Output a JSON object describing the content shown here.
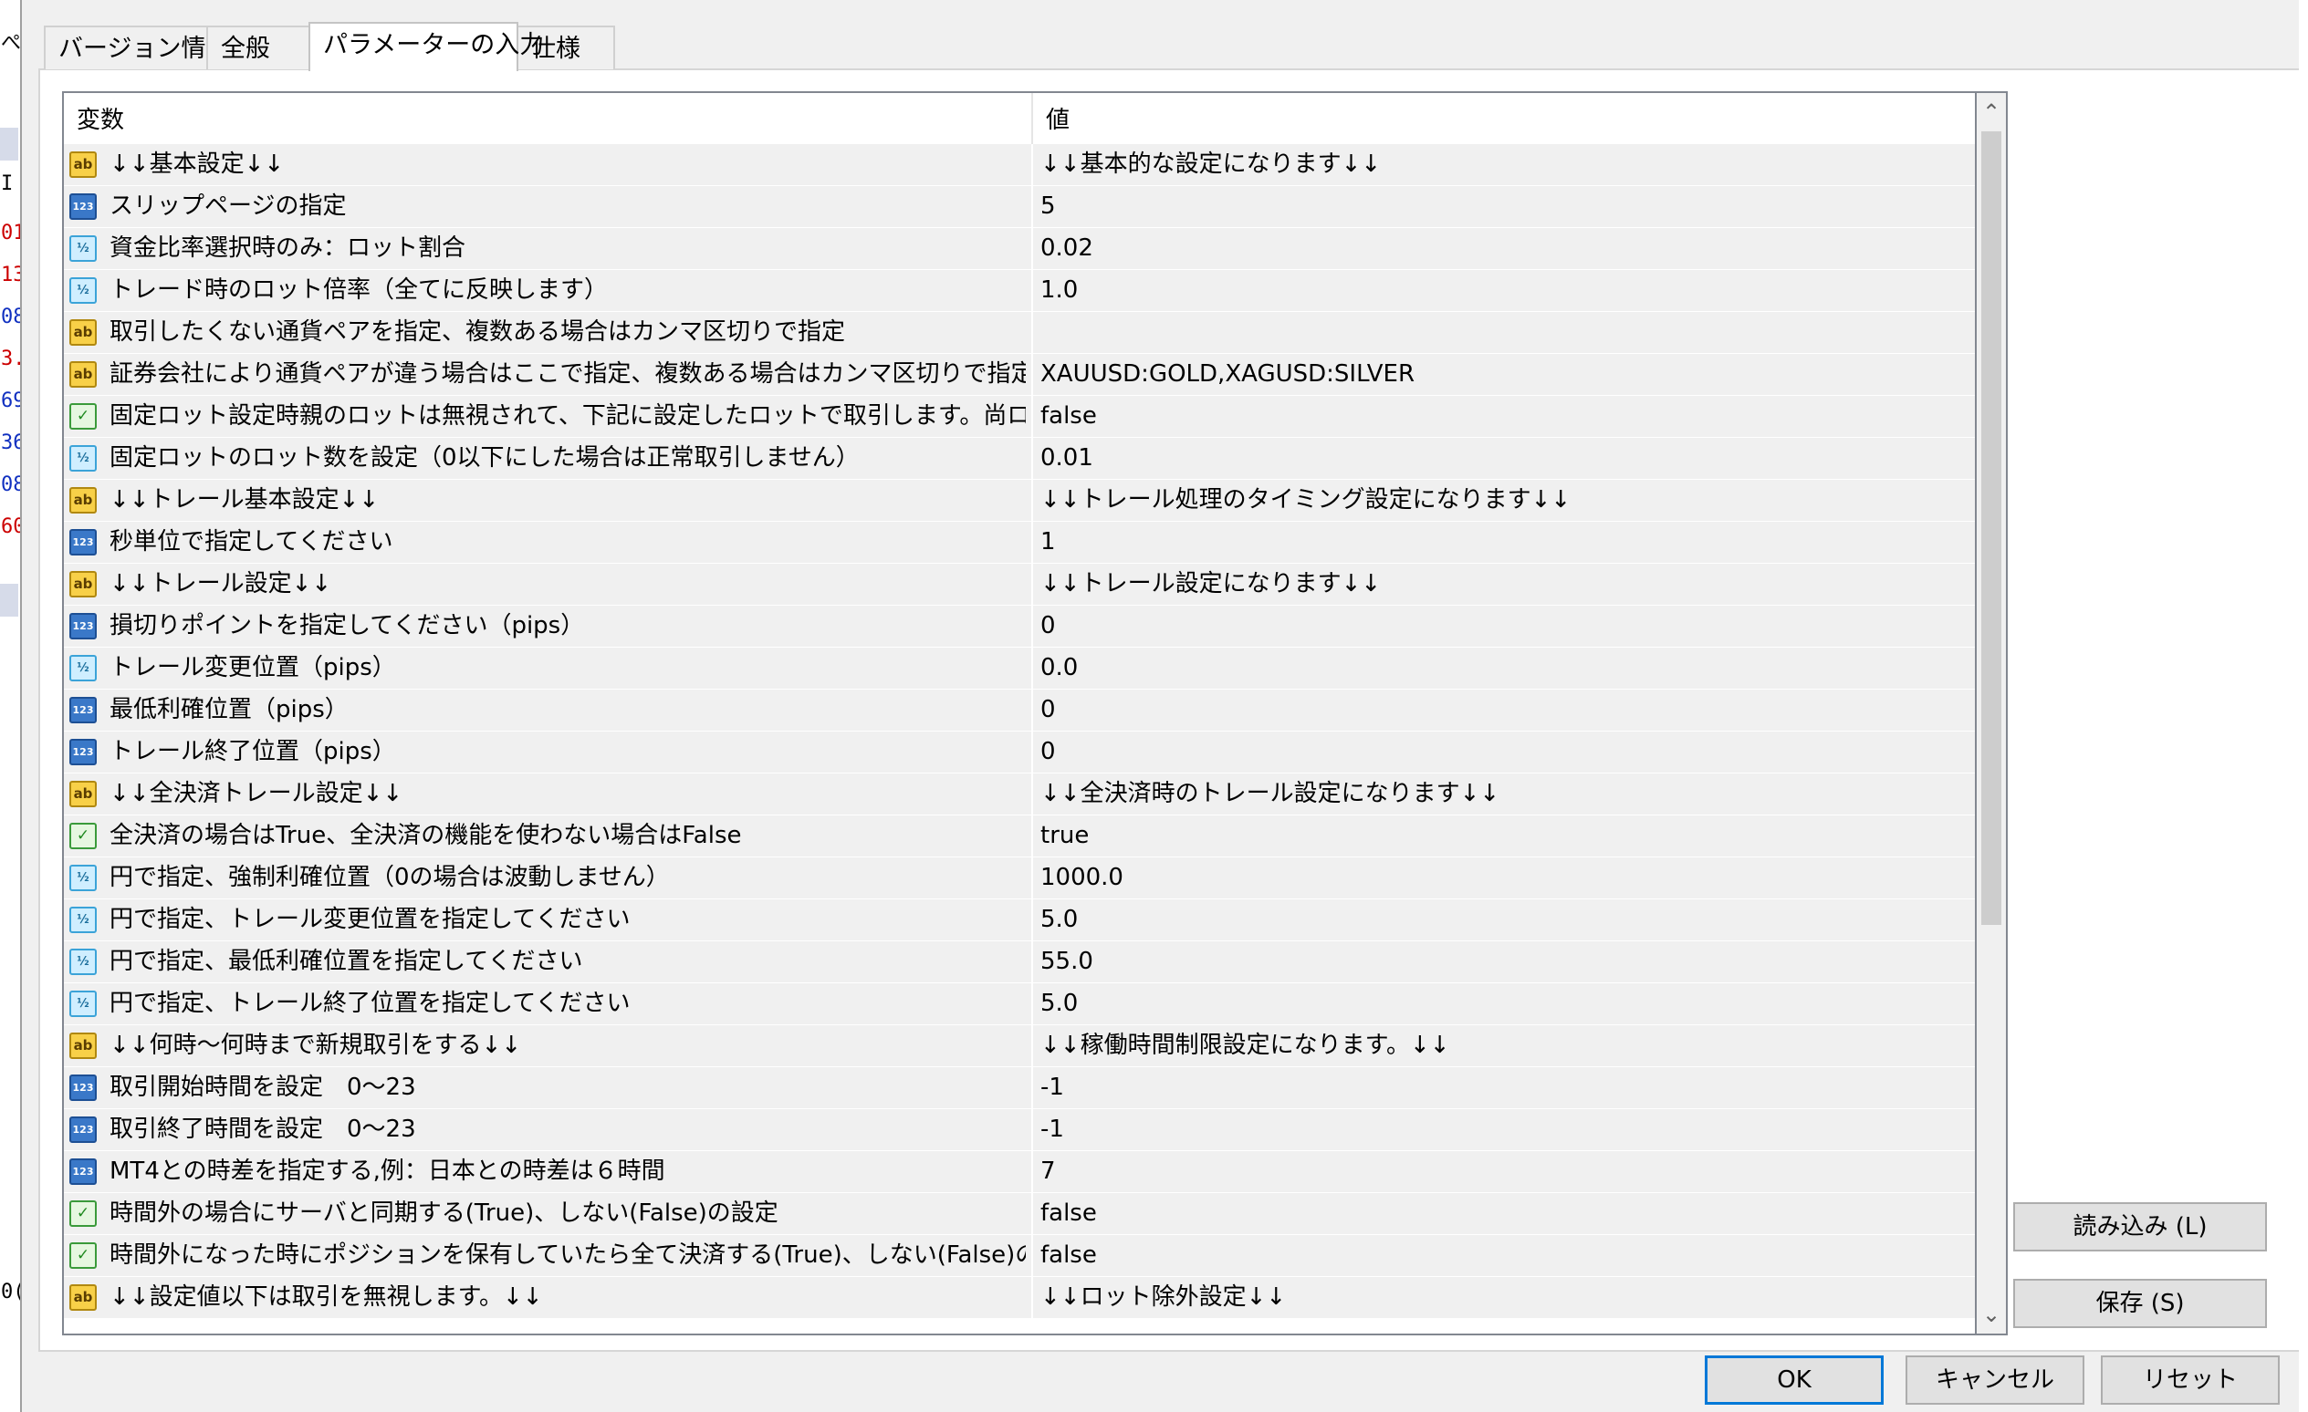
{
  "left_fragments": [
    "ぺ",
    "I",
    "01",
    "13",
    "08",
    "3.",
    "69",
    "36",
    "08",
    "60",
    "0("
  ],
  "tabs": [
    "バージョン情報",
    "全般",
    "パラメーターの入力",
    "仕様"
  ],
  "active_tab": 2,
  "grid": {
    "header": {
      "variable": "変数",
      "value": "値"
    },
    "rows": [
      {
        "icon": "str",
        "name": "↓↓基本設定↓↓",
        "value": "↓↓基本的な設定になります↓↓"
      },
      {
        "icon": "int",
        "name": "スリップページの指定",
        "value": "5"
      },
      {
        "icon": "dbl",
        "name": "資金比率選択時のみ：ロット割合",
        "value": "0.02"
      },
      {
        "icon": "dbl",
        "name": "トレード時のロット倍率（全てに反映します）",
        "value": "1.0"
      },
      {
        "icon": "str",
        "name": "取引したくない通貨ペアを指定、複数ある場合はカンマ区切りで指定",
        "value": ""
      },
      {
        "icon": "str",
        "name": "証券会社により通貨ペアが違う場合はここで指定、複数ある場合はカンマ区切りで指定",
        "value": "XAUUSD:GOLD,XAGUSD:SILVER"
      },
      {
        "icon": "bool",
        "name": "固定ロット設定時親のロットは無視されて、下記に設定したロットで取引します。尚ロット・..",
        "value": "false"
      },
      {
        "icon": "dbl",
        "name": "固定ロットのロット数を設定（0以下にした場合は正常取引しません）",
        "value": "0.01"
      },
      {
        "icon": "str",
        "name": "↓↓トレール基本設定↓↓",
        "value": "↓↓トレール処理のタイミング設定になります↓↓"
      },
      {
        "icon": "int",
        "name": "秒単位で指定してください",
        "value": "1"
      },
      {
        "icon": "str",
        "name": "↓↓トレール設定↓↓",
        "value": "↓↓トレール設定になります↓↓"
      },
      {
        "icon": "int",
        "name": "損切りポイントを指定してください（pips）",
        "value": "0"
      },
      {
        "icon": "dbl",
        "name": "トレール変更位置（pips）",
        "value": "0.0"
      },
      {
        "icon": "int",
        "name": "最低利確位置（pips）",
        "value": "0"
      },
      {
        "icon": "int",
        "name": "トレール終了位置（pips）",
        "value": "0"
      },
      {
        "icon": "str",
        "name": "↓↓全決済トレール設定↓↓",
        "value": "↓↓全決済時のトレール設定になります↓↓"
      },
      {
        "icon": "bool",
        "name": "全決済の場合はTrue、全決済の機能を使わない場合はFalse",
        "value": "true"
      },
      {
        "icon": "dbl",
        "name": "円で指定、強制利確位置（0の場合は波動しません）",
        "value": "1000.0"
      },
      {
        "icon": "dbl",
        "name": "円で指定、トレール変更位置を指定してください",
        "value": "5.0"
      },
      {
        "icon": "dbl",
        "name": "円で指定、最低利確位置を指定してください",
        "value": "55.0"
      },
      {
        "icon": "dbl",
        "name": "円で指定、トレール終了位置を指定してください",
        "value": "5.0"
      },
      {
        "icon": "str",
        "name": "↓↓何時〜何時まで新規取引をする↓↓",
        "value": "↓↓稼働時間制限設定になります。↓↓"
      },
      {
        "icon": "int",
        "name": "取引開始時間を設定　0〜23",
        "value": "-1"
      },
      {
        "icon": "int",
        "name": "取引終了時間を設定　0〜23",
        "value": "-1"
      },
      {
        "icon": "int",
        "name": "MT4との時差を指定する,例：日本との時差は６時間",
        "value": "7"
      },
      {
        "icon": "bool",
        "name": "時間外の場合にサーバと同期する(True)、しない(False)の設定",
        "value": "false"
      },
      {
        "icon": "bool",
        "name": "時間外になった時にポジションを保有していたら全て決済する(True)、しない(False)の設定...",
        "value": "false"
      },
      {
        "icon": "str",
        "name": "↓↓設定値以下は取引を無視します。↓↓",
        "value": "↓↓ロット除外設定↓↓"
      }
    ]
  },
  "icon_glyphs": {
    "str": "ab",
    "int": "123",
    "dbl": "½",
    "bool": "✓"
  },
  "buttons": {
    "load": "読み込み (L)",
    "save": "保存 (S)",
    "ok": "OK",
    "cancel": "キャンセル",
    "reset": "リセット"
  },
  "colors": {
    "row_bg": "#f0f0f0",
    "grid_border": "#828790",
    "default_button_border": "#0078d7",
    "left_red": "#cc0000",
    "left_blue": "#1030c0"
  }
}
